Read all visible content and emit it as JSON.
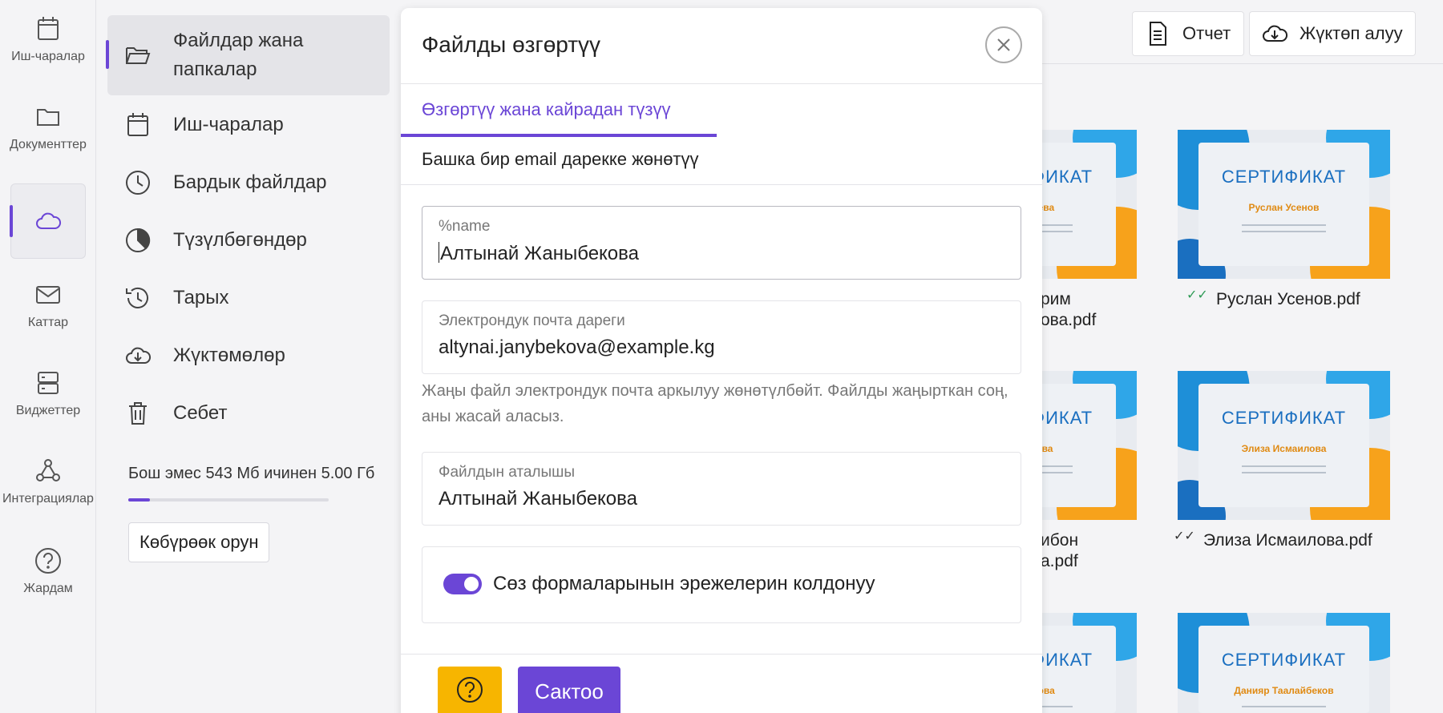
{
  "rail": {
    "items": [
      {
        "label": "Иш-чаралар",
        "icon": "calendar-icon"
      },
      {
        "label": "Документтер",
        "icon": "folder-icon"
      },
      {
        "label": "",
        "icon": "cloud-icon"
      },
      {
        "label": "Каттар",
        "icon": "mail-icon"
      },
      {
        "label": "Виджеттер",
        "icon": "widgets-icon"
      },
      {
        "label": "Интеграциялар",
        "icon": "integration-icon"
      },
      {
        "label": "Жардам",
        "icon": "help-icon"
      }
    ]
  },
  "sidebar": {
    "items": [
      {
        "label": "Файлдар жана папкалар",
        "icon": "folder-open-icon"
      },
      {
        "label": "Иш-чаралар",
        "icon": "calendar-icon"
      },
      {
        "label": "Бардык файлдар",
        "icon": "clock-icon"
      },
      {
        "label": "Түзүлбөгөндөр",
        "icon": "pie-icon"
      },
      {
        "label": "Тарых",
        "icon": "history-icon"
      },
      {
        "label": "Жүктөмөлөр",
        "icon": "cloud-download-icon"
      },
      {
        "label": "Себет",
        "icon": "trash-icon"
      }
    ],
    "storage_text": "Бош эмес 543 Мб ичинен 5.00 Гб",
    "storage_used_fraction": 0.106,
    "more_space_label": "Көбүрөөк орун"
  },
  "toolbar": {
    "report_label": "Отчет",
    "download_label": "Жүктөп алуу"
  },
  "grid": {
    "cert_title": "СЕРТИФИКАТ",
    "files": [
      {
        "name_partial_1": "рим",
        "name_partial_2": "ова.pdf",
        "person": "…галиева"
      },
      {
        "name": "Руслан Усенов.pdf",
        "person": "Руслан Усенов",
        "status": "sent"
      },
      {
        "name_partial_1": "ибон",
        "name_partial_2": "а.pdf",
        "person": "…марова"
      },
      {
        "name": "Элиза Исмаилова.pdf",
        "person": "Элиза Исмаилова",
        "status": "read"
      },
      {
        "person": "…йбекова"
      },
      {
        "person": "Данияр Таалайбеков"
      }
    ]
  },
  "modal": {
    "title": "Файлды өзгөртүү",
    "tabs": [
      {
        "label": "Өзгөртүү жана кайрадан түзүү"
      },
      {
        "label": "Башка бир email дарекке жөнөтүү"
      }
    ],
    "name_field": {
      "label": "%name",
      "value": "Алтынай Жаныбекова"
    },
    "email_field": {
      "label": "Электрондук почта дареги",
      "value": "altynai.janybekova@example.kg"
    },
    "hint": "Жаңы файл электрондук почта аркылуу жөнөтүлбөйт. Файлды жаңырткан соң, аны жасай аласыз.",
    "filename_field": {
      "label": "Файлдын аталышы",
      "value": "Алтынай Жаныбекова"
    },
    "toggle_label": "Сөз формаларынын эрежелерин колдонуу",
    "save_label": "Сактоо",
    "accent_color": "#6b46d6"
  }
}
